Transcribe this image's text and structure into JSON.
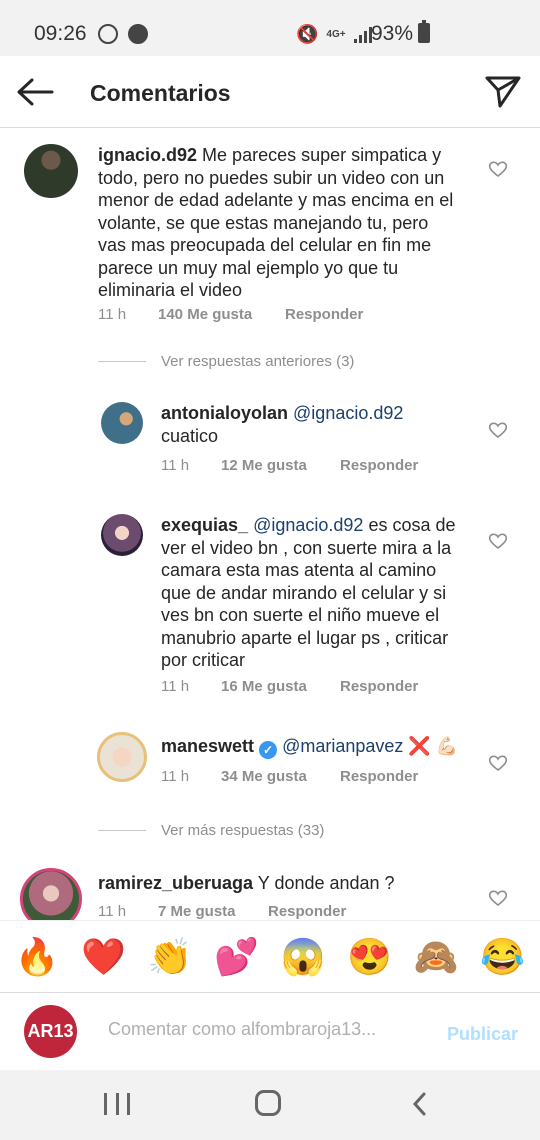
{
  "status_bar": {
    "time": "09:26",
    "battery": "93%",
    "network": "4G+"
  },
  "header": {
    "title": "Comentarios"
  },
  "comments": [
    {
      "user": "ignacio.d92",
      "text": "Me pareces super simpatica y todo, pero no puedes subir un video con un menor de edad adelante y mas encima en el volante, se que estas manejando tu, pero vas mas preocupada del celular en fin me parece un muy mal ejemplo yo que tu eliminaria el video",
      "time": "11 h",
      "likes": "140 Me gusta",
      "reply": "Responder"
    }
  ],
  "replies_prev": "Ver respuestas anteriores (3)",
  "replies": [
    {
      "user": "antonialoyolan",
      "mention": "@ignacio.d92",
      "text": "cuatico",
      "time": "11 h",
      "likes": "12 Me gusta",
      "reply": "Responder"
    },
    {
      "user": "exequias_",
      "mention": "@ignacio.d92",
      "text": "es cosa de ver el video bn , con suerte mira a la camara esta mas atenta al camino que de andar mirando el celular y si ves bn con suerte el niño mueve el manubrio aparte el lugar ps , criticar por criticar",
      "time": "11 h",
      "likes": "16 Me gusta",
      "reply": "Responder"
    },
    {
      "user": "maneswett",
      "mention": "@marianpavez",
      "text": "❌ 💪🏻",
      "time": "11 h",
      "likes": "34 Me gusta",
      "reply": "Responder"
    }
  ],
  "replies_more": "Ver más respuestas (33)",
  "last_comment": {
    "user": "ramirez_uberuaga",
    "text": "Y donde andan ?",
    "time": "11 h",
    "likes": "7 Me gusta",
    "reply": "Responder"
  },
  "emojis": [
    "🔥",
    "❤️",
    "👏",
    "💕",
    "😱",
    "😍",
    "🙈",
    "😂"
  ],
  "input": {
    "avatar_text": "AR13",
    "placeholder": "Comentar como alfombraroja13...",
    "publish": "Publicar"
  },
  "colors": {
    "mention": "#1c3f6e",
    "publish": "#b2dffc",
    "verified": "#3897f0"
  }
}
